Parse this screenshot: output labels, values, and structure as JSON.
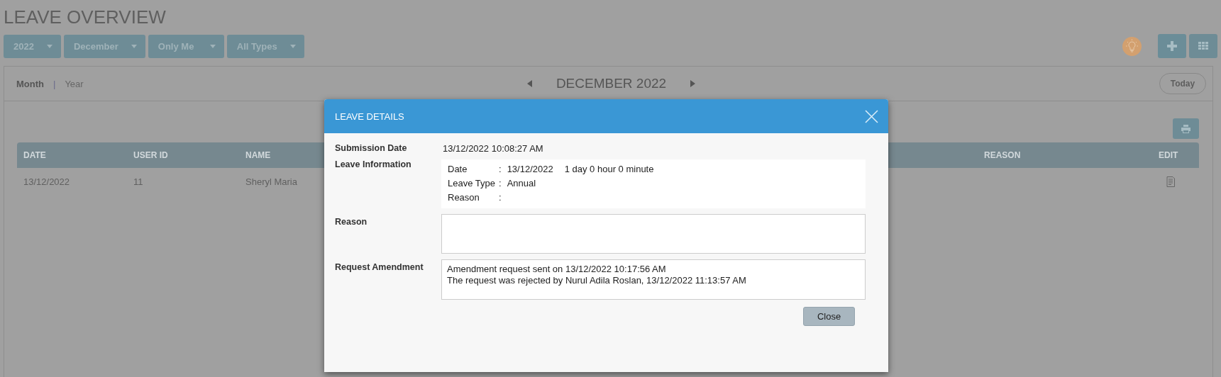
{
  "page_title": "LEAVE OVERVIEW",
  "filters": [
    {
      "label": "2022"
    },
    {
      "label": "December"
    },
    {
      "label": "Only Me"
    },
    {
      "label": "All Types"
    }
  ],
  "view_tabs": [
    {
      "label": "Month",
      "selected": true
    },
    {
      "label": "Year",
      "selected": false
    }
  ],
  "separator": "|",
  "period": "DECEMBER 2022",
  "today_button": "Today",
  "table": {
    "columns": [
      "DATE",
      "USER ID",
      "NAME",
      "REASON",
      "EDIT"
    ],
    "rows": [
      {
        "date": "13/12/2022",
        "user_id": "11",
        "name": "Sheryl Maria",
        "reason": ""
      }
    ]
  },
  "modal": {
    "title": "LEAVE DETAILS",
    "submission_label": "Submission Date",
    "submission_value": "13/12/2022 10:08:27 AM",
    "info_label": "Leave Information",
    "info_rows": [
      {
        "label": "Date",
        "colon": ":",
        "value": "13/12/2022",
        "extra": "1 day 0 hour 0 minute"
      },
      {
        "label": "Leave Type",
        "colon": ":",
        "value": "Annual"
      },
      {
        "label": "Reason",
        "colon": ":"
      }
    ],
    "reason_label": "Reason",
    "amendment_label": "Request Amendment",
    "amendment_lines": [
      "Amendment request sent on 13/12/2022 10:17:56 AM",
      "The request was rejected by Nurul Adila Roslan, 13/12/2022 11:13:57 AM"
    ],
    "close_button": "Close"
  }
}
